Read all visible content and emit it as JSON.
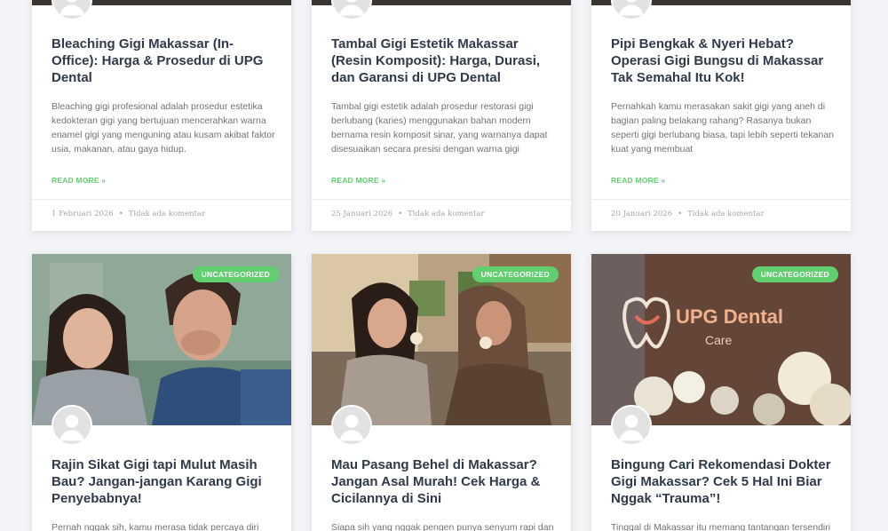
{
  "posts_top": [
    {
      "title": "Bleaching Gigi Makassar (In-Office): Harga & Prosedur di UPG Dental",
      "excerpt": "Bleaching gigi profesional adalah prosedur estetika kedokteran gigi yang bertujuan mencerahkan warna enamel gigi yang menguning atau kusam akibat faktor usia, makanan, atau gaya hidup.",
      "read_more": "READ MORE »",
      "date": "1 Februari 2026",
      "comments": "Tidak ada komentar"
    },
    {
      "title": "Tambal Gigi Estetik Makassar (Resin Komposit): Harga, Durasi, dan Garansi di UPG Dental",
      "excerpt": "Tambal gigi estetik adalah prosedur restorasi gigi berlubang (karies) menggunakan bahan modern bernama resin komposit sinar, yang warnanya dapat disesuaikan secara presisi dengan warna gigi",
      "read_more": "READ MORE »",
      "date": "25 Januari 2026",
      "comments": "Tidak ada komentar"
    },
    {
      "title": "Pipi Bengkak & Nyeri Hebat? Operasi Gigi Bungsu di Makassar Tak Semahal Itu Kok!",
      "excerpt": "Pernahkah kamu merasakan sakit gigi yang aneh di bagian paling belakang rahang? Rasanya bukan seperti gigi berlubang biasa, tapi lebih seperti tekanan kuat yang membuat",
      "read_more": "READ MORE »",
      "date": "20 Januari 2026",
      "comments": "Tidak ada komentar"
    }
  ],
  "posts_bottom": [
    {
      "category": "UNCATEGORIZED",
      "title": "Rajin Sikat Gigi tapi Mulut Masih Bau? Jangan-jangan Karang Gigi Penyebabnya!",
      "excerpt": "Pernah nggak sih, kamu merasa tidak percaya diri"
    },
    {
      "category": "UNCATEGORIZED",
      "title": "Mau Pasang Behel di Makassar? Jangan Asal Murah! Cek Harga & Cicilannya di Sini",
      "excerpt": "Siapa sih yang nggak pengen punya senyum rapi dan"
    },
    {
      "category": "UNCATEGORIZED",
      "title": "Bingung Cari Rekomendasi Dokter Gigi Makassar? Cek 5 Hal Ini Biar Nggak “Trauma”!",
      "excerpt": "Tinggal di Makassar itu memang tantangan tersendiri",
      "sign_text": "UPG Dental",
      "sign_sub": "Care"
    }
  ],
  "colors": {
    "accent": "#61ce70",
    "title": "#2f3a4a",
    "text": "#6f7378",
    "meta": "#a4a6a9"
  },
  "icons": {
    "avatar": "user-silhouette-icon"
  }
}
